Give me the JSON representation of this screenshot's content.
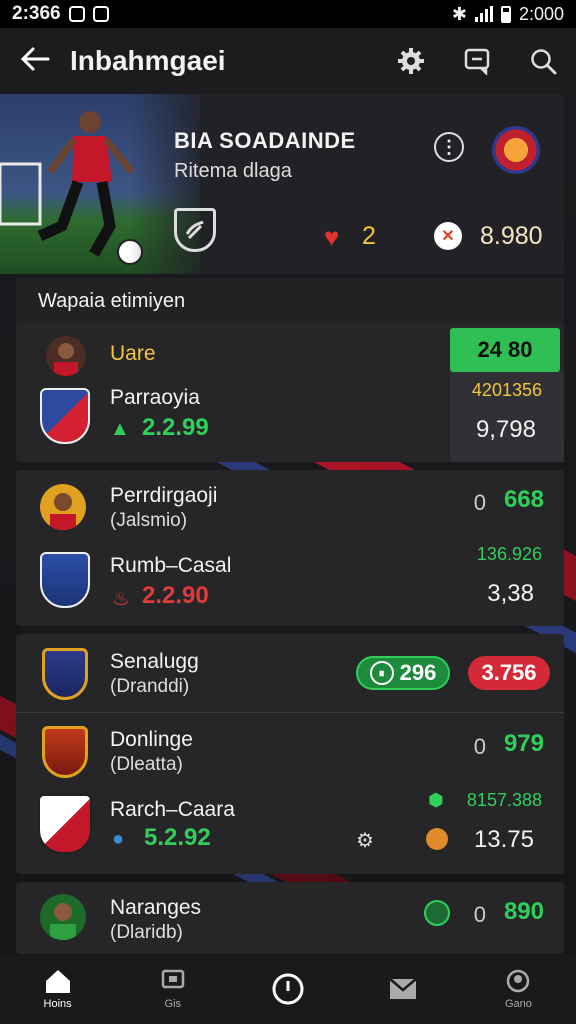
{
  "status": {
    "time_left": "2:366",
    "time_right": "2:000"
  },
  "appbar": {
    "title": "Inbahmgaei"
  },
  "hero": {
    "name": "BIA SOADAINDE",
    "subtitle": "Ritema dlaga",
    "likes": "2",
    "balance": "8.980"
  },
  "section": {
    "title": "Wapaia etimiyen"
  },
  "match1": {
    "row1": {
      "name": "Uare",
      "pill": "24 80"
    },
    "row2": {
      "name": "Parraoyia",
      "odds": "2.2.99",
      "top": "4201356",
      "value": "9,798"
    }
  },
  "match2": {
    "row1": {
      "name": "Perrdirgaoji",
      "sub": "(Jalsmio)",
      "badge": "0",
      "value": "668"
    },
    "row2": {
      "name": "Rumb–Casal",
      "odds": "2.2.90",
      "top": "136.926",
      "value": "3,38"
    }
  },
  "match3": {
    "row1": {
      "name": "Senalugg",
      "sub": "(Dranddi)",
      "pill_green": "296",
      "pill_red": "3.756"
    },
    "row2": {
      "name": "Donlinge",
      "sub": "(Dleatta)",
      "badge": "0",
      "value": "979"
    },
    "row3": {
      "name": "Rarch–Caara",
      "odds": "5.2.92",
      "top": "8157.388",
      "value": "13.75"
    }
  },
  "match4": {
    "row1": {
      "name": "Naranges",
      "sub": "(Dlaridb)",
      "badge": "0",
      "value": "890"
    }
  },
  "nav": {
    "home": "Hoins",
    "bets": "Gis",
    "live": "",
    "inbox": "",
    "profile": "Gano"
  }
}
